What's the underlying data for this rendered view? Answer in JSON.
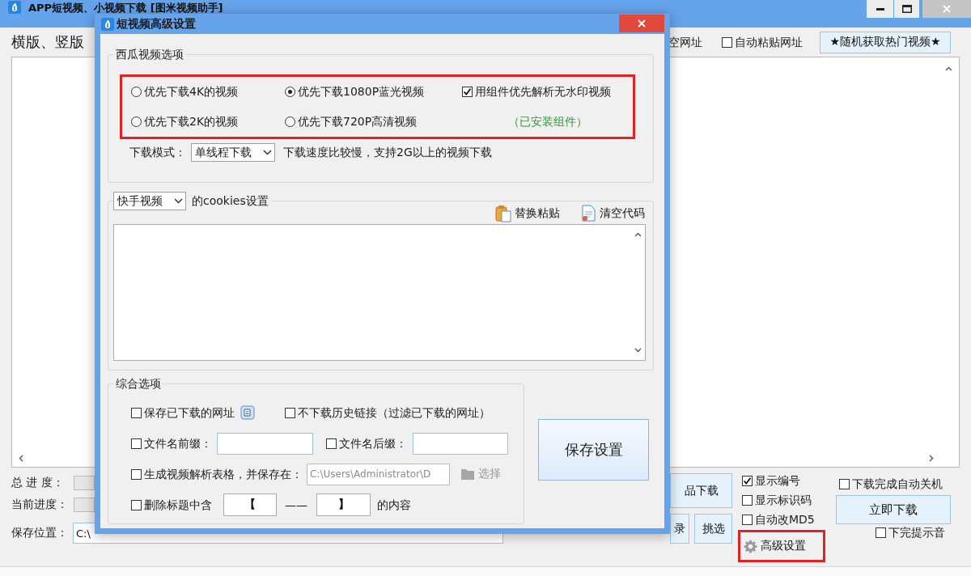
{
  "main_window": {
    "title": "APP短视频、小视频下载 [图米视频助手]",
    "heading": "横版、竖版",
    "toolbar": {
      "partial_label": "空网址",
      "auto_paste": {
        "label": "自动粘贴网址",
        "checked": false
      },
      "random_button": "★随机获取热门视频★"
    },
    "progress": [
      {
        "label": "总 进 度：",
        "level": 0
      },
      {
        "label": "当前进度：",
        "level": 0
      }
    ],
    "save_location": {
      "label": "保存位置：",
      "value": "C:\\"
    },
    "works_button": "品下载",
    "small_buttons": [
      "录",
      "挑选"
    ],
    "display_options": [
      {
        "label": "显示编号",
        "checked": true
      },
      {
        "label": "显示标识码",
        "checked": false
      },
      {
        "label": "自动改MD5",
        "checked": false
      }
    ],
    "advanced_button": {
      "label": "高级设置",
      "highlighted": true
    },
    "auto_shutdown": {
      "label": "下载完成自动关机",
      "checked": false
    },
    "download_button": "立即下载",
    "finish_sound": {
      "label": "下完提示音",
      "checked": false
    }
  },
  "dialog": {
    "title": "短视频高级设置",
    "xigua_group": {
      "legend": "西瓜视频选项",
      "highlighted": true,
      "options": [
        {
          "kind": "radio",
          "label": "优先下载4K的视频",
          "selected": false
        },
        {
          "kind": "radio",
          "label": "优先下载1080P蓝光视频",
          "selected": true
        },
        {
          "kind": "checkbox",
          "label": "用组件优先解析无水印视频",
          "checked": true
        },
        {
          "kind": "radio",
          "label": "优先下载2K的视频",
          "selected": false
        },
        {
          "kind": "radio",
          "label": "优先下载720P高清视频",
          "selected": false
        },
        {
          "kind": "note",
          "label": "（已安装组件）"
        }
      ],
      "download_mode": {
        "label": "下载模式：",
        "value": "单线程下载",
        "hint": "下载速度比较慢，支持2G以上的视频下载"
      }
    },
    "cookies_group": {
      "platform": "快手视频",
      "label": "的cookies设置",
      "buttons": [
        {
          "label": "替换粘贴"
        },
        {
          "label": "清空代码"
        }
      ]
    },
    "general_group": {
      "legend": "综合选项",
      "save_urls": {
        "label": "保存已下载的网址",
        "checked": false
      },
      "skip_history": {
        "label": "不下载历史链接（过滤已下载的网址）",
        "checked": false
      },
      "prefix": {
        "label": "文件名前缀：",
        "checked": false
      },
      "suffix": {
        "label": "文件名后缀：",
        "checked": false
      },
      "table": {
        "label": "生成视频解析表格，并保存在：",
        "checked": false,
        "path": "C:\\Users\\Administrator\\D",
        "disabled": true,
        "button": "选择"
      },
      "strip": {
        "label": "删除标题中含",
        "checked": false,
        "start": "【",
        "separator": "——",
        "end": "】",
        "tail": "的内容"
      }
    },
    "save_button": "保存设置"
  }
}
